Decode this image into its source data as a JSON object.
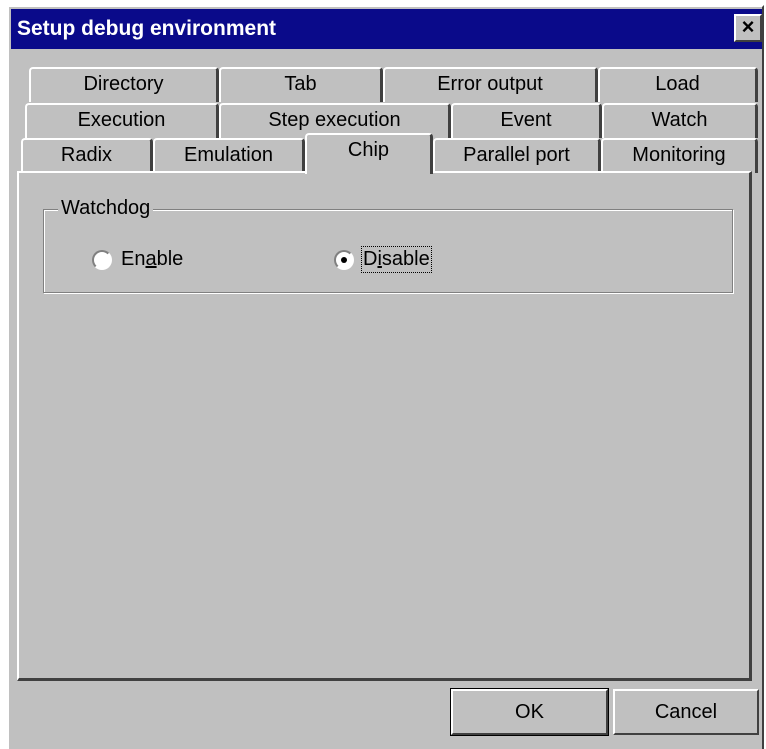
{
  "window": {
    "title": "Setup debug environment",
    "close_glyph": "×"
  },
  "tabs": {
    "row1": [
      {
        "label": "Directory"
      },
      {
        "label": "Tab"
      },
      {
        "label": "Error output"
      },
      {
        "label": "Load"
      }
    ],
    "row2": [
      {
        "label": "Execution"
      },
      {
        "label": "Step execution"
      },
      {
        "label": "Event"
      },
      {
        "label": "Watch"
      }
    ],
    "row3": [
      {
        "label": "Radix"
      },
      {
        "label": "Emulation"
      },
      {
        "label": "Chip"
      },
      {
        "label": "Parallel port"
      },
      {
        "label": "Monitoring"
      }
    ],
    "active": "Chip"
  },
  "watchdog": {
    "group_label": "Watchdog",
    "enable": {
      "pre": "En",
      "mnemonic": "a",
      "post": "ble",
      "selected": false
    },
    "disable": {
      "pre": "D",
      "mnemonic": "i",
      "post": "sable",
      "selected": true
    }
  },
  "buttons": {
    "ok": "OK",
    "cancel": "Cancel"
  }
}
